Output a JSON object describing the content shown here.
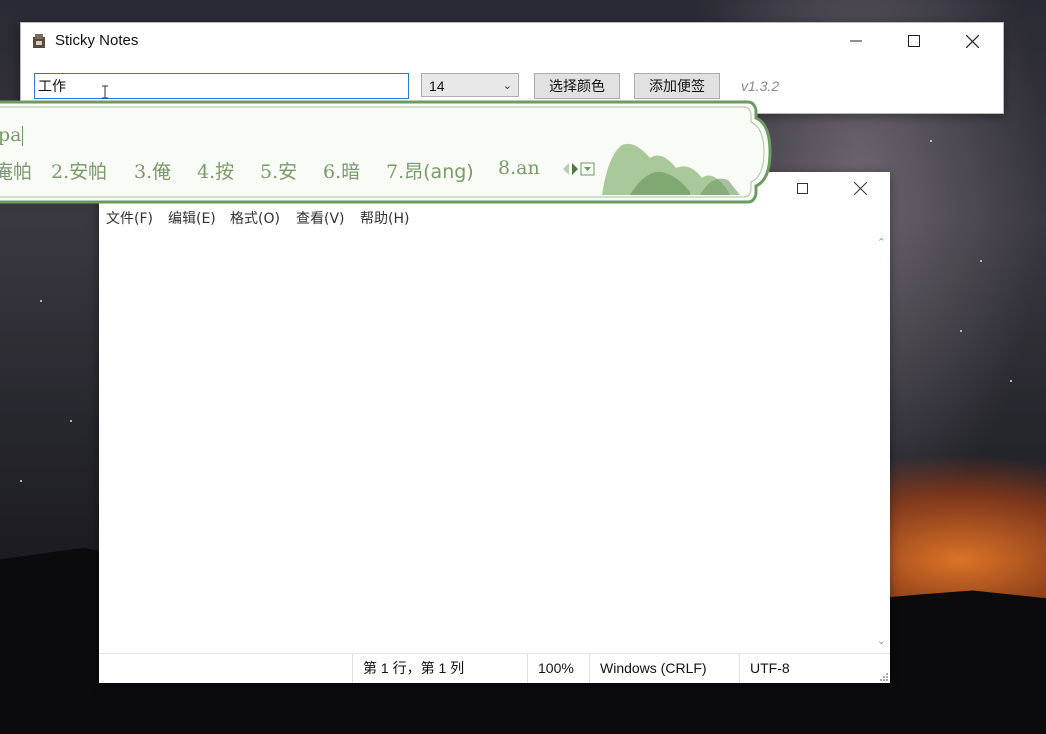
{
  "sticky_window": {
    "title": "Sticky Notes",
    "note_input_value": "工作",
    "font_size": "14",
    "choose_color_label": "选择颜色",
    "add_note_label": "添加便签",
    "version": "v1.3.2"
  },
  "notepad": {
    "menu": [
      "文件(F)",
      "编辑(E)",
      "格式(O)",
      "查看(V)",
      "帮助(H)"
    ],
    "status": {
      "position": "第 1 行，第 1 列",
      "zoom": "100%",
      "line_ending": "Windows (CRLF)",
      "encoding": "UTF-8"
    }
  },
  "ime": {
    "composition": "pa",
    "candidates": [
      {
        "text": "庵帕"
      },
      {
        "text": "2.安帕"
      },
      {
        "text": "3.俺"
      },
      {
        "text": "4.按"
      },
      {
        "text": "5.安"
      },
      {
        "text": "6.暗"
      },
      {
        "text": "7.昂",
        "pinyin": "(ang)"
      },
      {
        "text": "8.an"
      }
    ],
    "accent_color": "#6f9a62"
  }
}
